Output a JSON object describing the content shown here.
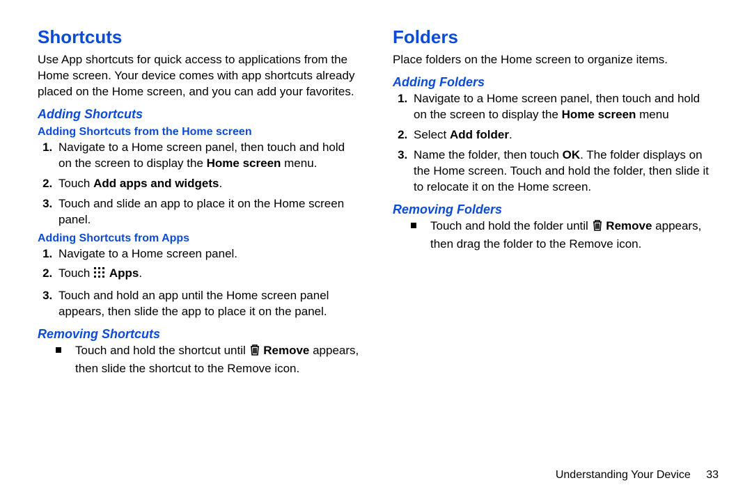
{
  "left": {
    "title": "Shortcuts",
    "intro": "Use App shortcuts for quick access to applications from the Home screen. Your device comes with app shortcuts already placed on the Home screen, and you can add your favorites.",
    "adding_heading": "Adding Shortcuts",
    "from_home_heading": "Adding Shortcuts from the Home screen",
    "from_home_steps": {
      "s1_a": "Navigate to a Home screen panel, then touch and hold on the screen to display the ",
      "s1_b": "Home screen",
      "s1_c": " menu.",
      "s2_a": "Touch ",
      "s2_b": "Add apps and widgets",
      "s2_c": ".",
      "s3": "Touch and slide an app to place it on the Home screen panel."
    },
    "from_apps_heading": "Adding Shortcuts from Apps",
    "from_apps_steps": {
      "s1": "Navigate to a Home screen panel.",
      "s2_a": "Touch ",
      "s2_b": "Apps",
      "s2_c": ".",
      "s3": "Touch and hold an app until the Home screen panel appears, then slide the app to place it on the panel."
    },
    "removing_heading": "Removing Shortcuts",
    "removing_bullet": {
      "a": "Touch and hold the shortcut until ",
      "b": "Remove",
      "c": " appears, then slide the shortcut to the Remove icon."
    }
  },
  "right": {
    "title": "Folders",
    "intro": "Place folders on the Home screen to organize items.",
    "adding_heading": "Adding Folders",
    "adding_steps": {
      "s1_a": "Navigate to a Home screen panel, then touch and hold on the screen to display the ",
      "s1_b": "Home screen",
      "s1_c": " menu",
      "s2_a": "Select ",
      "s2_b": "Add folder",
      "s2_c": ".",
      "s3_a": "Name the folder, then touch ",
      "s3_b": "OK",
      "s3_c": ". The folder displays on the Home screen. Touch and hold the folder, then slide it to relocate it on the Home screen."
    },
    "removing_heading": "Removing Folders",
    "removing_bullet": {
      "a": "Touch and hold the folder until ",
      "b": "Remove",
      "c": " appears, then drag the folder to the Remove icon."
    }
  },
  "footer": {
    "section": "Understanding Your Device",
    "page": "33"
  }
}
